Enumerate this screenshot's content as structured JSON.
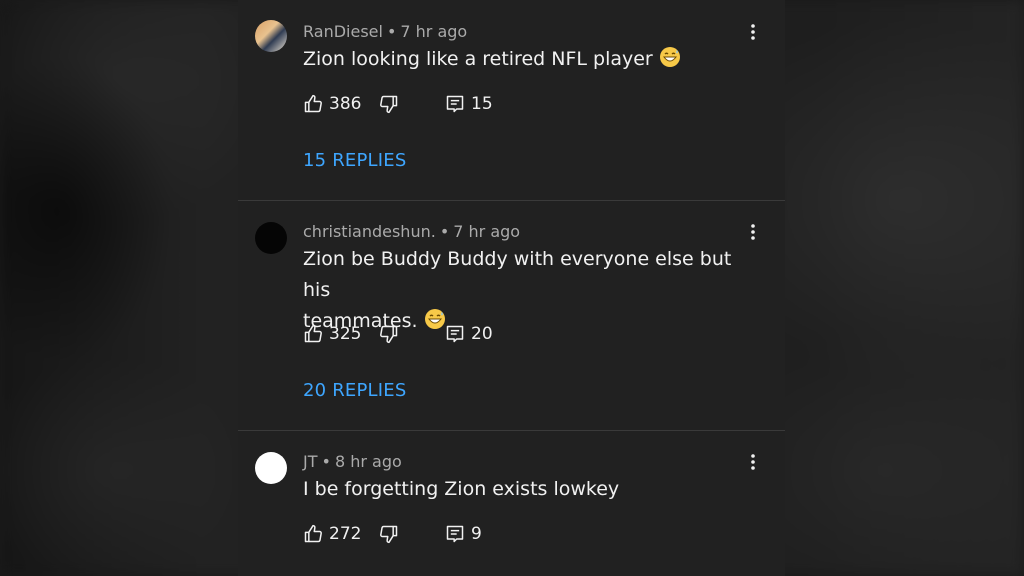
{
  "colors": {
    "panel_bg": "#212121",
    "reply_link": "#3ea6ff",
    "meta_text": "#aaaaaa",
    "body_text": "#f1f1f1"
  },
  "comments": [
    {
      "author": "RanDiesel",
      "separator": "•",
      "time": "7 hr ago",
      "text": "Zion looking like a retired NFL player",
      "emoji": "grinning-sweat-emoji",
      "likes": "386",
      "reply_count": "15",
      "replies_link": "15 REPLIES"
    },
    {
      "author": "christiandeshun.",
      "separator": "•",
      "time": "7 hr ago",
      "text_line1": "Zion be Buddy Buddy with everyone else but his",
      "text_line2": "teammates.",
      "emoji": "grinning-sweat-emoji",
      "likes": "325",
      "reply_count": "20",
      "replies_link": "20 REPLIES"
    },
    {
      "author": "JT",
      "separator": "•",
      "time": "8 hr ago",
      "text": "I be forgetting Zion exists lowkey",
      "likes": "272",
      "reply_count": "9"
    }
  ],
  "icons": [
    "more-options-icon",
    "thumbs-up-icon",
    "thumbs-down-icon",
    "reply-icon",
    "grinning-sweat-emoji"
  ]
}
